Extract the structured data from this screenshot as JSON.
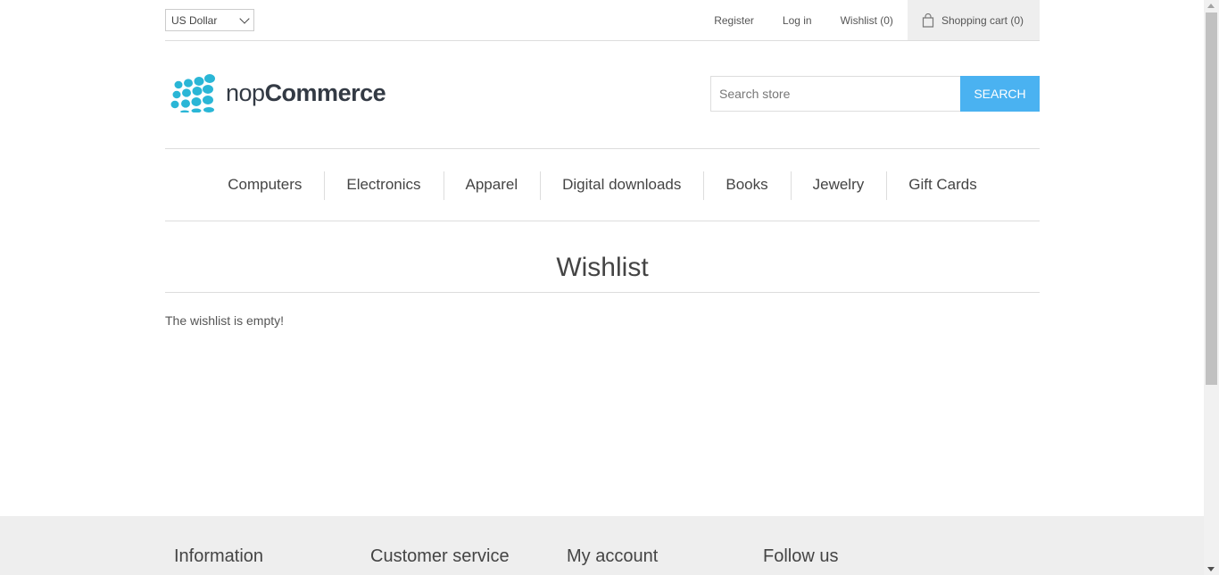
{
  "header": {
    "currency": "US Dollar",
    "links": {
      "register": "Register",
      "login": "Log in",
      "wishlist": "Wishlist (0)",
      "cart": "Shopping cart (0)"
    }
  },
  "logo": {
    "part1": "nop",
    "part2": "Commerce"
  },
  "search": {
    "placeholder": "Search store",
    "button": "SEARCH"
  },
  "menu": {
    "items": [
      {
        "label": "Computers"
      },
      {
        "label": "Electronics"
      },
      {
        "label": "Apparel"
      },
      {
        "label": "Digital downloads"
      },
      {
        "label": "Books"
      },
      {
        "label": "Jewelry"
      },
      {
        "label": "Gift Cards"
      }
    ]
  },
  "main": {
    "title": "Wishlist",
    "empty_message": "The wishlist is empty!"
  },
  "footer": {
    "columns": [
      {
        "title": "Information"
      },
      {
        "title": "Customer service"
      },
      {
        "title": "My account"
      },
      {
        "title": "Follow us"
      }
    ]
  },
  "colors": {
    "accent": "#4ab2f1",
    "logo_dots": "#2ab6d6",
    "logo_text": "#333a44",
    "footer_bg": "#eeeeee"
  }
}
